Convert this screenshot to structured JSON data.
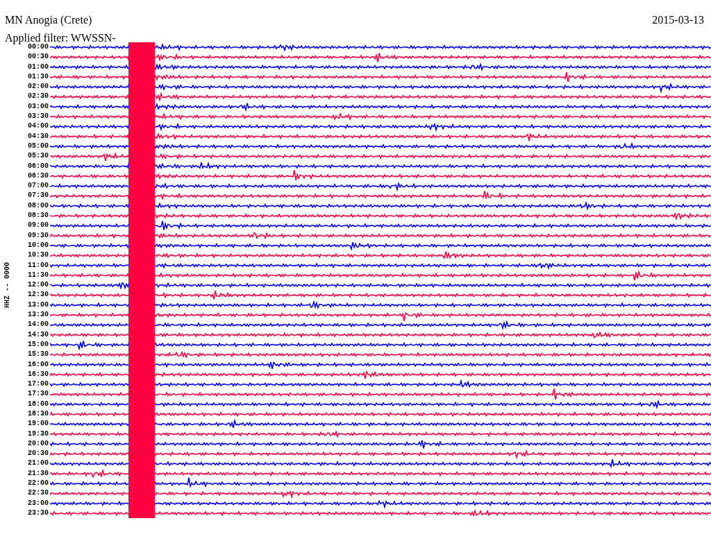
{
  "title": "MN Anogia (Crete)",
  "date": "2015-03-13",
  "filter": "Applied filter: WWSSN-",
  "channel_label": "HHZ -- 0000",
  "rows": [
    {
      "time": "00:00",
      "color": "#0000ff"
    },
    {
      "time": "00:30",
      "color": "#ff0040"
    },
    {
      "time": "01:00",
      "color": "#0000ff"
    },
    {
      "time": "01:30",
      "color": "#ff0040"
    },
    {
      "time": "02:00",
      "color": "#0000ff"
    },
    {
      "time": "02:30",
      "color": "#ff0040"
    },
    {
      "time": "03:00",
      "color": "#0000ff"
    },
    {
      "time": "03:30",
      "color": "#ff0040"
    },
    {
      "time": "04:00",
      "color": "#0000ff"
    },
    {
      "time": "04:30",
      "color": "#ff0040"
    },
    {
      "time": "05:00",
      "color": "#0000ff"
    },
    {
      "time": "05:30",
      "color": "#ff0040"
    },
    {
      "time": "06:00",
      "color": "#0000ff"
    },
    {
      "time": "06:30",
      "color": "#ff0040"
    },
    {
      "time": "07:00",
      "color": "#0000ff"
    },
    {
      "time": "07:30",
      "color": "#ff0040"
    },
    {
      "time": "08:00",
      "color": "#0000ff"
    },
    {
      "time": "08:30",
      "color": "#ff0040"
    },
    {
      "time": "09:00",
      "color": "#0000ff"
    },
    {
      "time": "09:30",
      "color": "#ff0040"
    },
    {
      "time": "10:00",
      "color": "#0000ff"
    },
    {
      "time": "10:30",
      "color": "#ff0040"
    },
    {
      "time": "11:00",
      "color": "#0000ff"
    },
    {
      "time": "11:30",
      "color": "#ff0040"
    },
    {
      "time": "12:00",
      "color": "#0000ff"
    },
    {
      "time": "12:30",
      "color": "#ff0040"
    },
    {
      "time": "13:00",
      "color": "#0000ff"
    },
    {
      "time": "13:30",
      "color": "#ff0040"
    },
    {
      "time": "14:00",
      "color": "#0000ff"
    },
    {
      "time": "14:30",
      "color": "#ff0040"
    },
    {
      "time": "15:00",
      "color": "#0000ff"
    },
    {
      "time": "15:30",
      "color": "#ff0040"
    },
    {
      "time": "16:00",
      "color": "#0000ff"
    },
    {
      "time": "16:30",
      "color": "#ff0040"
    },
    {
      "time": "17:00",
      "color": "#0000ff"
    },
    {
      "time": "17:30",
      "color": "#ff0040"
    },
    {
      "time": "18:00",
      "color": "#0000ff"
    },
    {
      "time": "18:30",
      "color": "#ff0040"
    },
    {
      "time": "19:00",
      "color": "#0000ff"
    },
    {
      "time": "19:30",
      "color": "#ff0040"
    },
    {
      "time": "20:00",
      "color": "#0000ff"
    },
    {
      "time": "20:30",
      "color": "#ff0040"
    },
    {
      "time": "21:00",
      "color": "#0000ff"
    },
    {
      "time": "21:30",
      "color": "#ff0040"
    },
    {
      "time": "22:00",
      "color": "#0000ff"
    },
    {
      "time": "22:30",
      "color": "#ff0040"
    },
    {
      "time": "23:00",
      "color": "#0000ff"
    },
    {
      "time": "23:30",
      "color": "#ff0040"
    }
  ]
}
